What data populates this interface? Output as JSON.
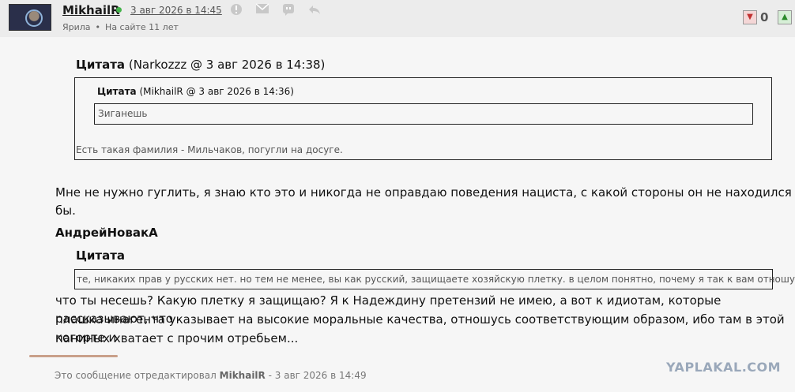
{
  "post": {
    "username": "MikhailR",
    "date": "3 авг 2026 в 14:45",
    "city": "Ярила",
    "separator": "•",
    "on_site": "На сайте 11 лет",
    "rating": "0"
  },
  "quote1": {
    "label": "Цитата",
    "meta": "(Narkozzz @ 3 авг 2026 в 14:38)",
    "inner_label": "Цитата",
    "inner_meta": "(MikhailR @ 3 авг 2026 в 14:36)",
    "inner_text": "Зиганешь",
    "text": "Есть такая фамилия - Мильчаков, погугли на досуге."
  },
  "reply1": "Мне не нужно гуглить, я знаю кто это и никогда не оправдаю поведения нациста, с какой стороны он не находился бы.",
  "author2": "АндрейНовакА",
  "quote2": {
    "label": "Цитата",
    "text": "те, никаких прав у русских нет. но тем не менее, вы как русский, защищаете хозяйскую плетку. в целом понятно, почему я так к вам отношусь?"
  },
  "reply2": {
    "line1": "что ты несешь? Какую плетку я защищаю? Я к Надеждину претензий не имею, а вот к идиотам, которые рассказывают, что",
    "line2": "плашка инагента указывает на высокие моральные качества, отношусь соответствующим образом, ибо там в этой когорте и",
    "line3": "паниных хватает с прочим отребьем..."
  },
  "edited": {
    "prefix": "Это сообщение отредактировал",
    "user": "MikhailR",
    "suffix": "- 3 авг 2026 в 14:49"
  },
  "watermark": "YAPLAKAL.COM",
  "icons": [
    "warning-icon",
    "mail-icon",
    "quote-icon",
    "reply-icon",
    "thumb-down-icon",
    "thumb-up-icon"
  ]
}
